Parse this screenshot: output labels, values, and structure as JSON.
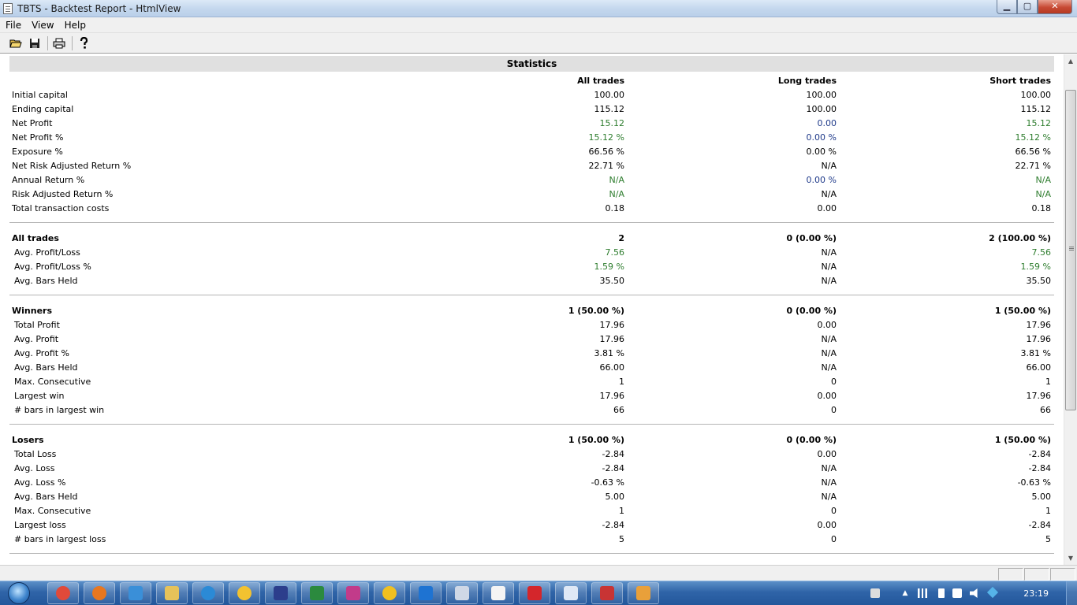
{
  "window": {
    "title": "TBTS - Backtest Report - HtmlView",
    "minimize": "▁",
    "maximize": "▢",
    "close": "✕"
  },
  "menu": [
    "File",
    "View",
    "Help"
  ],
  "toolbar_icons": [
    "open-folder-icon",
    "save-icon",
    "print-icon",
    "help-icon"
  ],
  "report": {
    "title": "Statistics",
    "columns": [
      "All trades",
      "Long trades",
      "Short trades"
    ],
    "sections": [
      {
        "rows": [
          {
            "label": "Initial capital",
            "values": [
              "100.00",
              "100.00",
              "100.00"
            ],
            "colors": [
              "",
              "",
              ""
            ]
          },
          {
            "label": "Ending capital",
            "values": [
              "115.12",
              "100.00",
              "115.12"
            ],
            "colors": [
              "",
              "",
              ""
            ]
          },
          {
            "label": "Net Profit",
            "values": [
              "15.12",
              "0.00",
              "15.12"
            ],
            "colors": [
              "green",
              "navy",
              "green"
            ]
          },
          {
            "label": "Net Profit %",
            "values": [
              "15.12 %",
              "0.00 %",
              "15.12 %"
            ],
            "colors": [
              "green",
              "navy",
              "green"
            ]
          },
          {
            "label": "Exposure %",
            "values": [
              "66.56 %",
              "0.00 %",
              "66.56 %"
            ],
            "colors": [
              "",
              "",
              ""
            ]
          },
          {
            "label": "Net Risk Adjusted Return %",
            "values": [
              "22.71 %",
              "N/A",
              "22.71 %"
            ],
            "colors": [
              "",
              "",
              ""
            ]
          },
          {
            "label": "Annual Return %",
            "values": [
              "N/A",
              "0.00 %",
              "N/A"
            ],
            "colors": [
              "green",
              "navy",
              "green"
            ]
          },
          {
            "label": "Risk Adjusted Return %",
            "values": [
              "N/A",
              "N/A",
              "N/A"
            ],
            "colors": [
              "green",
              "",
              "green"
            ]
          },
          {
            "label": "Total transaction costs",
            "values": [
              "0.18",
              "0.00",
              "0.18"
            ],
            "colors": [
              "",
              "",
              ""
            ]
          }
        ]
      },
      {
        "header": {
          "label": "All trades",
          "values": [
            "2",
            "0 (0.00 %)",
            "2 (100.00 %)"
          ]
        },
        "rows": [
          {
            "label": "Avg. Profit/Loss",
            "values": [
              "7.56",
              "N/A",
              "7.56"
            ],
            "colors": [
              "green",
              "",
              "green"
            ]
          },
          {
            "label": "Avg. Profit/Loss %",
            "values": [
              "1.59 %",
              "N/A",
              "1.59 %"
            ],
            "colors": [
              "green",
              "",
              "green"
            ]
          },
          {
            "label": "Avg. Bars Held",
            "values": [
              "35.50",
              "N/A",
              "35.50"
            ],
            "colors": [
              "",
              "",
              ""
            ]
          }
        ]
      },
      {
        "header": {
          "label": "Winners",
          "values": [
            "1 (50.00 %)",
            "0 (0.00 %)",
            "1 (50.00 %)"
          ]
        },
        "rows": [
          {
            "label": "Total Profit",
            "values": [
              "17.96",
              "0.00",
              "17.96"
            ],
            "colors": [
              "",
              "",
              ""
            ]
          },
          {
            "label": "Avg. Profit",
            "values": [
              "17.96",
              "N/A",
              "17.96"
            ],
            "colors": [
              "",
              "",
              ""
            ]
          },
          {
            "label": "Avg. Profit %",
            "values": [
              "3.81 %",
              "N/A",
              "3.81 %"
            ],
            "colors": [
              "",
              "",
              ""
            ]
          },
          {
            "label": "Avg. Bars Held",
            "values": [
              "66.00",
              "N/A",
              "66.00"
            ],
            "colors": [
              "",
              "",
              ""
            ]
          },
          {
            "label": "Max. Consecutive",
            "values": [
              "1",
              "0",
              "1"
            ],
            "colors": [
              "",
              "",
              ""
            ]
          },
          {
            "label": "Largest win",
            "values": [
              "17.96",
              "0.00",
              "17.96"
            ],
            "colors": [
              "",
              "",
              ""
            ]
          },
          {
            "label": "# bars in largest win",
            "values": [
              "66",
              "0",
              "66"
            ],
            "colors": [
              "",
              "",
              ""
            ]
          }
        ]
      },
      {
        "header": {
          "label": "Losers",
          "values": [
            "1 (50.00 %)",
            "0 (0.00 %)",
            "1 (50.00 %)"
          ]
        },
        "rows": [
          {
            "label": "Total Loss",
            "values": [
              "-2.84",
              "0.00",
              "-2.84"
            ],
            "colors": [
              "",
              "",
              ""
            ]
          },
          {
            "label": "Avg. Loss",
            "values": [
              "-2.84",
              "N/A",
              "-2.84"
            ],
            "colors": [
              "",
              "",
              ""
            ]
          },
          {
            "label": "Avg. Loss %",
            "values": [
              "-0.63 %",
              "N/A",
              "-0.63 %"
            ],
            "colors": [
              "",
              "",
              ""
            ]
          },
          {
            "label": "Avg. Bars Held",
            "values": [
              "5.00",
              "N/A",
              "5.00"
            ],
            "colors": [
              "",
              "",
              ""
            ]
          },
          {
            "label": "Max. Consecutive",
            "values": [
              "1",
              "0",
              "1"
            ],
            "colors": [
              "",
              "",
              ""
            ]
          },
          {
            "label": "Largest loss",
            "values": [
              "-2.84",
              "0.00",
              "-2.84"
            ],
            "colors": [
              "",
              "",
              ""
            ]
          },
          {
            "label": "# bars in largest loss",
            "values": [
              "5",
              "0",
              "5"
            ],
            "colors": [
              "",
              "",
              ""
            ]
          }
        ]
      }
    ]
  },
  "colors": {
    "positive": "#2e7d2e",
    "neutral": "#1f3a8a",
    "header_bg": "#e0e0e0"
  },
  "taskbar": {
    "apps": [
      {
        "name": "chrome-icon",
        "color": "#e04a3a"
      },
      {
        "name": "firefox-icon",
        "color": "#e8771f"
      },
      {
        "name": "internet-explorer-icon",
        "color": "#3a8fd8"
      },
      {
        "name": "file-explorer-icon",
        "color": "#e6c25a"
      },
      {
        "name": "skype-icon",
        "color": "#2b8ad6"
      },
      {
        "name": "messenger-icon",
        "color": "#f2c230"
      },
      {
        "name": "night-app-icon",
        "color": "#2c3e8c"
      },
      {
        "name": "excel-icon",
        "color": "#2b8a3e"
      },
      {
        "name": "triangle-app-icon",
        "color": "#c23b8a"
      },
      {
        "name": "smiley-app-icon",
        "color": "#f0c020"
      },
      {
        "name": "teamviewer-icon",
        "color": "#1e73d2"
      },
      {
        "name": "notepad-icon",
        "color": "#cfd8e6"
      },
      {
        "name": "document-icon",
        "color": "#f4f4f4"
      },
      {
        "name": "pdf-icon",
        "color": "#d4262b"
      },
      {
        "name": "window-app-icon",
        "color": "#dfe8f5"
      },
      {
        "name": "chart-app-icon",
        "color": "#c83434"
      },
      {
        "name": "paint-icon",
        "color": "#e9a03a"
      }
    ],
    "clock": "23:19"
  }
}
